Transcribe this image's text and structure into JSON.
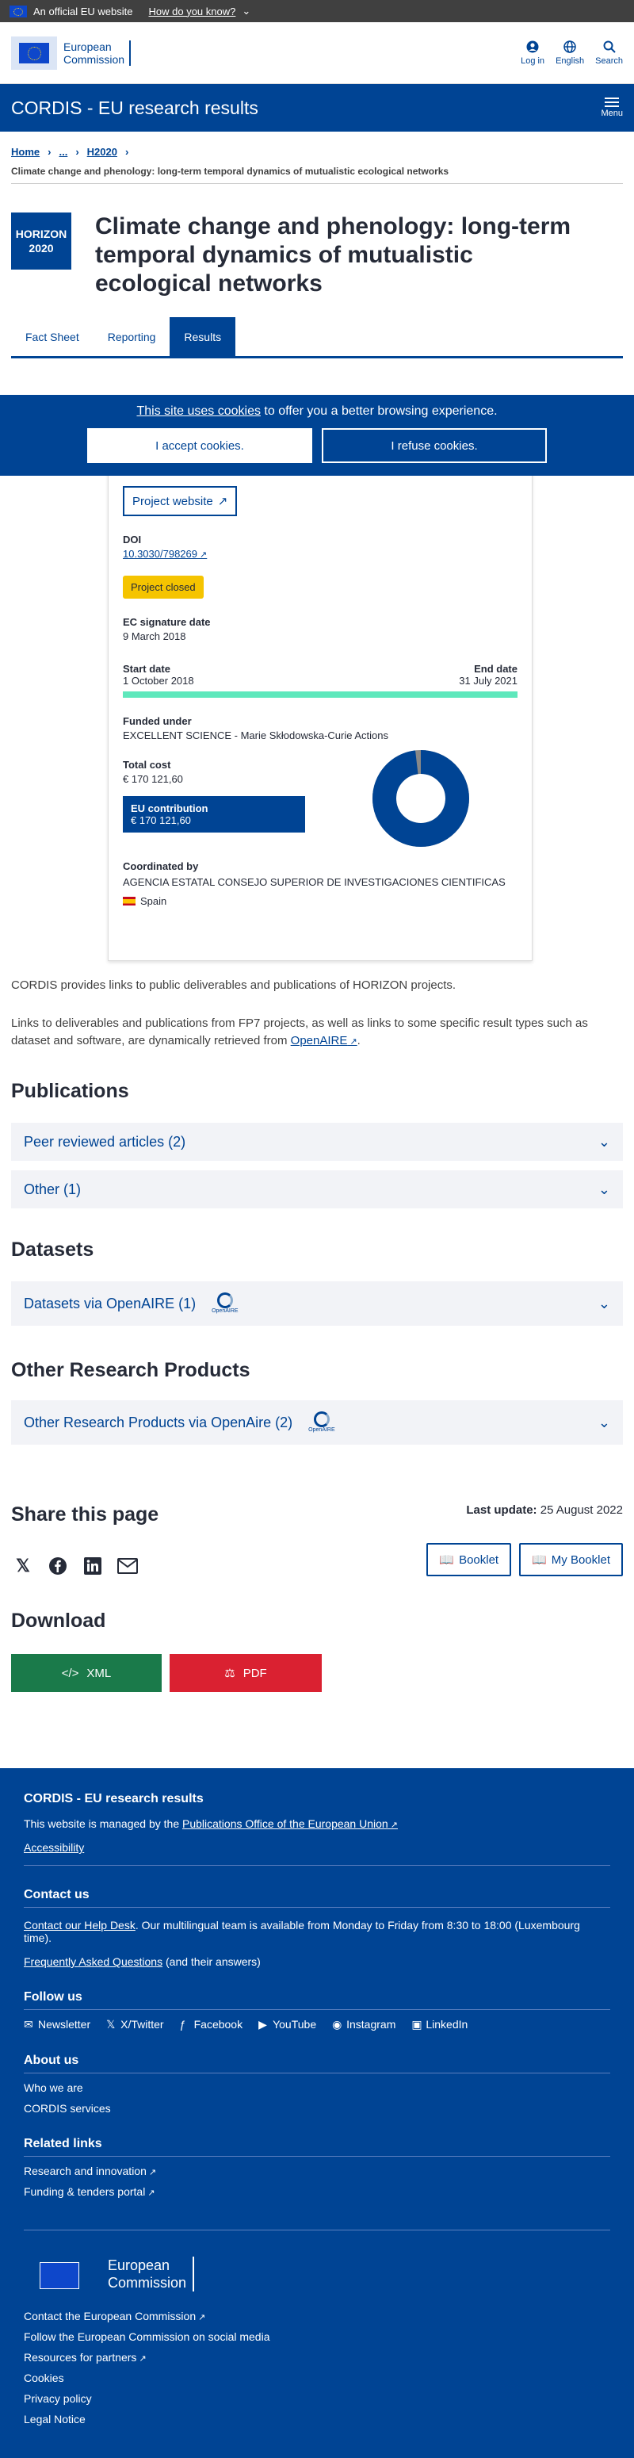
{
  "topbar": {
    "official": "An official EU website",
    "how": "How do you know?"
  },
  "header": {
    "logo_line1": "European",
    "logo_line2": "Commission",
    "login": "Log in",
    "language": "English",
    "search": "Search"
  },
  "sitebar": {
    "title": "CORDIS - EU research results",
    "menu": "Menu"
  },
  "breadcrumb": {
    "home": "Home",
    "ellipsis": "...",
    "h2020": "H2020"
  },
  "page_subtitle": "Climate change and phenology: long-term temporal dynamics of mutualistic ecological networks",
  "horizon": {
    "line1": "HORIZON",
    "line2": "2020"
  },
  "title": "Climate change and phenology: long-term temporal dynamics of mutualistic ecological networks",
  "tabs": [
    "Fact Sheet",
    "Reporting",
    "Results"
  ],
  "cookie": {
    "link": "This site uses cookies",
    "text": " to offer you a better browsing experience.",
    "accept": "I accept cookies.",
    "refuse": "I refuse cookies."
  },
  "project": {
    "website": "Project website",
    "doi_label": "DOI",
    "doi": "10.3030/798269",
    "status": "Project closed",
    "sig_label": "EC signature date",
    "sig_date": "9 March 2018",
    "start_label": "Start date",
    "start": "1 October 2018",
    "end_label": "End date",
    "end": "31 July 2021",
    "funded_label": "Funded under",
    "funded": "EXCELLENT SCIENCE - Marie Skłodowska-Curie Actions",
    "cost_label": "Total cost",
    "cost": "€ 170 121,60",
    "eu_label": "EU contribution",
    "eu": "€ 170 121,60",
    "eu_share": 0.98,
    "coord_label": "Coordinated by",
    "coord": "AGENCIA ESTATAL CONSEJO SUPERIOR DE INVESTIGACIONES CIENTIFICAS",
    "country": "Spain"
  },
  "info1": "CORDIS provides links to public deliverables and publications of HORIZON projects.",
  "info2a": "Links to deliverables and publications from FP7 projects, as well as links to some specific result types such as dataset and software, are dynamically retrieved from ",
  "info2_link": "OpenAIRE",
  "info2b": ".",
  "publications": {
    "title": "Publications",
    "peer": "Peer reviewed articles (2)",
    "other": "Other (1)"
  },
  "datasets": {
    "title": "Datasets",
    "item": "Datasets via OpenAIRE (1)"
  },
  "other_products": {
    "title": "Other Research Products",
    "item": "Other Research Products via OpenAire (2)"
  },
  "openaire_logo": "OpenAIRE",
  "share": {
    "title": "Share this page",
    "last_label": "Last update:",
    "last_date": "25 August 2022",
    "booklet": "Booklet",
    "mybooklet": "My Booklet"
  },
  "download": {
    "title": "Download",
    "xml": "XML",
    "pdf": "PDF"
  },
  "colors": {
    "primary": "#004494",
    "badge": "#f5c400",
    "progress": "#5ee8bc",
    "xml": "#1a7a4a",
    "pdf": "#da2131"
  },
  "footer": {
    "title": "CORDIS - EU research results",
    "managed_pre": "This website is managed by the ",
    "managed_link": "Publications Office of the European Union",
    "accessibility": "Accessibility",
    "contact_title": "Contact us",
    "helpdesk_link": "Contact our Help Desk",
    "helpdesk_text": ". Our multilingual team is available from Monday to Friday from 8:30 to 18:00 (Luxembourg time).",
    "faq_link": "Frequently Asked Questions",
    "faq_text": " (and their answers)",
    "follow_title": "Follow us",
    "follow": [
      "Newsletter",
      "X/Twitter",
      "Facebook",
      "YouTube",
      "Instagram",
      "LinkedIn"
    ],
    "about_title": "About us",
    "about": [
      "Who we are",
      "CORDIS services"
    ],
    "related_title": "Related links",
    "related": [
      "Research and innovation",
      "Funding & tenders portal"
    ],
    "ec_line1": "European",
    "ec_line2": "Commission",
    "ec_links": [
      "Contact the European Commission",
      "Follow the European Commission on social media",
      "Resources for partners",
      "Cookies",
      "Privacy policy",
      "Legal Notice"
    ]
  }
}
